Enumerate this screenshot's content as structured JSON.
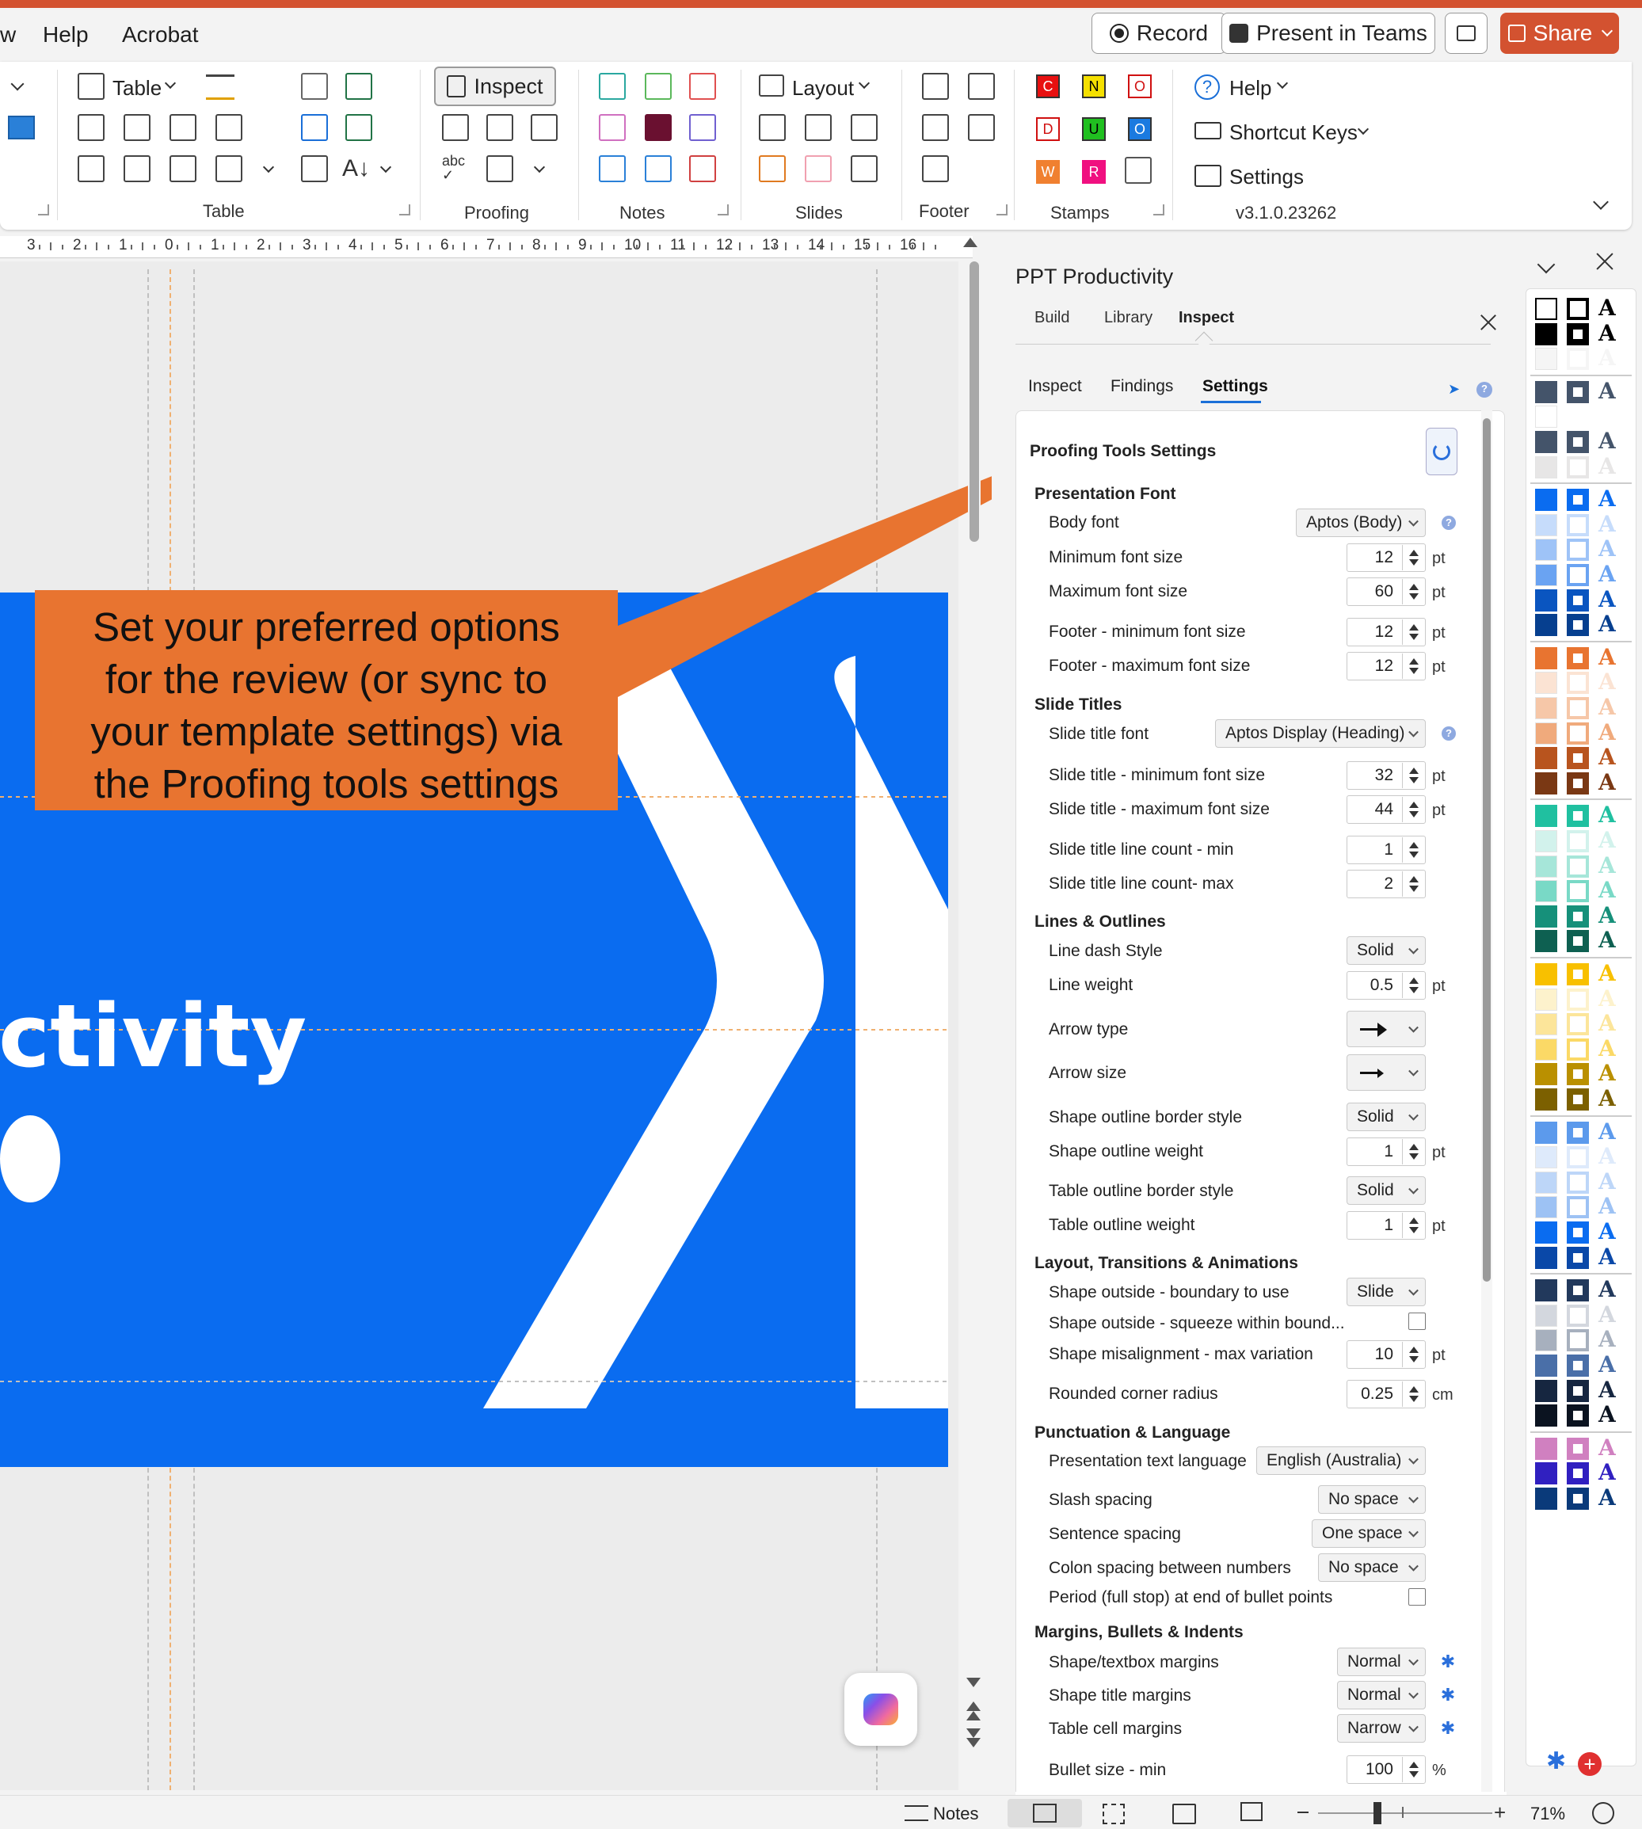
{
  "menu": {
    "partial_left": "w",
    "help": "Help",
    "acrobat": "Acrobat"
  },
  "top_buttons": {
    "record": "Record",
    "present_in_teams": "Present in Teams",
    "share": "Share"
  },
  "ribbon": {
    "table_label": "Table",
    "table_group": "Table",
    "inspect_label": "Inspect",
    "proofing_group": "Proofing",
    "notes_group": "Notes",
    "layout_label": "Layout",
    "slides_group": "Slides",
    "footer_group": "Footer",
    "stamps_group": "Stamps",
    "stamps": [
      "C",
      "N",
      "O",
      "D",
      "U",
      "O",
      "W",
      "R"
    ],
    "help_label": "Help",
    "shortcut_keys_label": "Shortcut Keys",
    "settings_label": "Settings",
    "version": "v3.1.0.23262"
  },
  "ruler": {
    "ticks": [
      "3",
      "2",
      "1",
      "0",
      "1",
      "2",
      "3",
      "4",
      "5",
      "6",
      "7",
      "8",
      "9",
      "10",
      "11",
      "12",
      "13",
      "14",
      "15",
      "16"
    ]
  },
  "slide": {
    "title_fragment": "ctivity"
  },
  "callout": {
    "text_lines": [
      "Set your preferred options",
      "for the review (or sync to",
      "your template settings) via",
      "the Proofing tools settings"
    ],
    "color": "#e87430"
  },
  "pane": {
    "title": "PPT Productivity",
    "main_tabs": [
      "Build",
      "Library",
      "Inspect"
    ],
    "sub_tabs": [
      "Inspect",
      "Findings",
      "Settings"
    ],
    "section_title": "Proofing Tools Settings",
    "presentation_font": {
      "heading": "Presentation Font",
      "body_font_label": "Body font",
      "body_font_value": "Aptos (Body)",
      "min_label": "Minimum font size",
      "min_value": "12",
      "max_label": "Maximum font size",
      "max_value": "60",
      "footer_min_label": "Footer - minimum font size",
      "footer_min_value": "12",
      "footer_max_label": "Footer - maximum font size",
      "footer_max_value": "12"
    },
    "slide_titles": {
      "heading": "Slide Titles",
      "font_label": "Slide title font",
      "font_value": "Aptos Display (Heading)",
      "min_label": "Slide title - minimum font size",
      "min_value": "32",
      "max_label": "Slide title - maximum font size",
      "max_value": "44",
      "lc_min_label": "Slide title line count - min",
      "lc_min_value": "1",
      "lc_max_label": "Slide title line count- max",
      "lc_max_value": "2"
    },
    "lines": {
      "heading": "Lines & Outlines",
      "dash_label": "Line dash Style",
      "dash_value": "Solid",
      "weight_label": "Line weight",
      "weight_value": "0.5",
      "arrow_type_label": "Arrow type",
      "arrow_size_label": "Arrow size",
      "shape_border_label": "Shape outline border style",
      "shape_border_value": "Solid",
      "shape_weight_label": "Shape outline weight",
      "shape_weight_value": "1",
      "table_border_label": "Table outline border style",
      "table_border_value": "Solid",
      "table_weight_label": "Table outline weight",
      "table_weight_value": "1"
    },
    "layout": {
      "heading": "Layout, Transitions & Animations",
      "boundary_label": "Shape outside - boundary to use",
      "boundary_value": "Slide",
      "squeeze_label": "Shape outside - squeeze within bound...",
      "misalign_label": "Shape misalignment - max variation",
      "misalign_value": "10",
      "radius_label": "Rounded corner radius",
      "radius_value": "0.25"
    },
    "punct": {
      "heading": "Punctuation & Language",
      "lang_label": "Presentation text language",
      "lang_value": "English (Australia)",
      "slash_label": "Slash spacing",
      "slash_value": "No space",
      "sentence_label": "Sentence spacing",
      "sentence_value": "One space",
      "colon_label": "Colon spacing between numbers",
      "colon_value": "No space",
      "period_label": "Period (full stop) at end of bullet points"
    },
    "margins": {
      "heading": "Margins, Bullets & Indents",
      "shape_label": "Shape/textbox margins",
      "shape_value": "Normal",
      "title_label": "Shape title margins",
      "title_value": "Normal",
      "table_label": "Table cell margins",
      "table_value": "Narrow",
      "bullet_label": "Bullet size - min",
      "bullet_value": "100"
    },
    "units": {
      "pt": "pt",
      "cm": "cm",
      "pct": "%"
    }
  },
  "status": {
    "notes": "Notes",
    "zoom": "71%"
  },
  "colors": {
    "accent_orange": "#e87430",
    "slide_blue": "#0a6cf0",
    "share_red": "#d35230"
  }
}
